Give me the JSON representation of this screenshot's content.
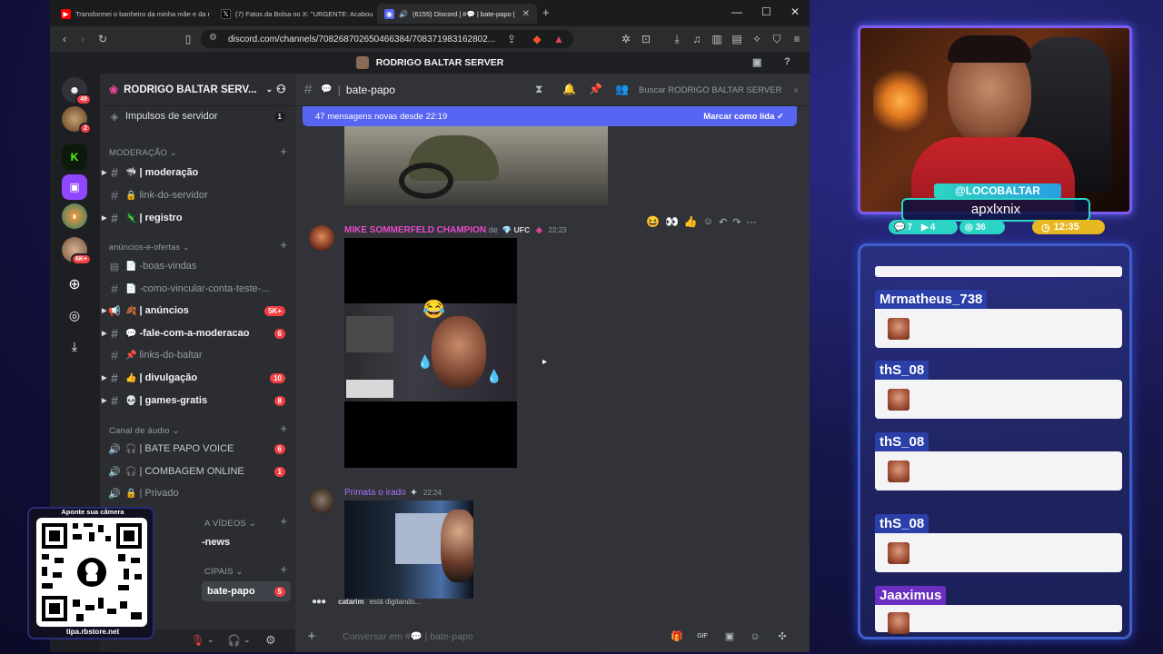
{
  "browser": {
    "tabs": [
      {
        "title": "Transformei o banheiro da minha mãe e da m",
        "icon": "youtube-icon",
        "color": "#ff0000"
      },
      {
        "title": "(7) Fatos da Bolsa no X: \"URGENTE: Acabou",
        "icon": "x-icon",
        "color": "#000000"
      },
      {
        "title": "(6155) Discord | #💬 | bate-papo |",
        "icon": "discord-icon",
        "color": "#5865f2"
      }
    ],
    "url": "discord.com/channels/708268702650466384/708371983162802...",
    "new_tab": "+"
  },
  "discord": {
    "top_title": "RODRIGO BALTAR SERVER",
    "guilds": [
      {
        "badge": "49"
      },
      {
        "badge": "2"
      },
      {
        "badge": ""
      },
      {
        "badge": ""
      },
      {
        "badge": ""
      },
      {
        "badge": "6K+"
      }
    ],
    "server": {
      "name": "RODRIGO BALTAR SERV...",
      "boost": "Impulsos de servidor",
      "boost_count": "1",
      "categories": [
        {
          "label": "MODERAÇÃO ⌄"
        },
        {
          "label": "anúncios-e-ofertas ⌄"
        },
        {
          "label": "Canal de áudio ⌄"
        },
        {
          "label": "A VÍDEOS ⌄"
        },
        {
          "label": "CIPAIS ⌄"
        }
      ],
      "channels": [
        {
          "label": "| moderação",
          "emoji": "🦈",
          "unread": true
        },
        {
          "label": "link-do-servidor",
          "emoji": "🔒",
          "unread": false
        },
        {
          "label": "| registro",
          "emoji": "🦎",
          "unread": true
        },
        {
          "label": "-boas-vindas",
          "emoji": "📄",
          "unread": false
        },
        {
          "label": "-como-vincular-conta-teste-...",
          "emoji": "📄",
          "unread": false
        },
        {
          "label": "| anúncios",
          "emoji": "🍂",
          "unread": true,
          "count": "5K+"
        },
        {
          "label": "-fale-com-a-moderacao",
          "emoji": "💬",
          "unread": true,
          "count": "6"
        },
        {
          "label": "links-do-baltar",
          "emoji": "📌",
          "unread": false
        },
        {
          "label": "| divulgação",
          "emoji": "👍",
          "unread": true,
          "count": "10"
        },
        {
          "label": "| games-gratis",
          "emoji": "💀",
          "unread": true,
          "count": "8"
        },
        {
          "label": "| BATE PAPO VOICE",
          "emoji": "🎧",
          "unread": false,
          "count": "6"
        },
        {
          "label": "| COMBAGEM ONLINE",
          "emoji": "🎧",
          "unread": false,
          "count": "1"
        },
        {
          "label": "| Privado",
          "emoji": "🔒",
          "unread": false
        },
        {
          "label": "-news",
          "emoji": "",
          "unread": true
        },
        {
          "label": "bate-papo",
          "emoji": "",
          "unread": true,
          "count": "5"
        }
      ]
    },
    "chat": {
      "channel": "bate-papo",
      "search_placeholder": "Buscar RODRIGO BALTAR SERVER",
      "new_messages": "47 mensagens novas desde 22:19",
      "mark_read": "Marcar como lida",
      "messages": [
        {
          "author": "MIKE SOMMERFELD CHAMPION",
          "suffix": "de",
          "tag": "UFC",
          "time": "22:23",
          "name_color": "#e84ac9"
        },
        {
          "author": "Primata o irado",
          "time": "22:24",
          "name_color": "#a970ff"
        }
      ],
      "typing_user": "catarim",
      "typing_text": "está digitando...",
      "composer_placeholder": "Conversar em #💬 | bate-papo"
    }
  },
  "qr": {
    "title": "Aponte sua câmera",
    "url": "tipa.rbstore.net"
  },
  "stream": {
    "handle": "@LOCOBALTAR",
    "game": "apxlxnix",
    "stats": [
      {
        "icon": "chat-icon",
        "value": "7"
      },
      {
        "icon": "video-icon",
        "value": "4"
      },
      {
        "icon": "heart-icon",
        "value": "36"
      },
      {
        "icon": "clock-icon",
        "value": "12:35"
      }
    ]
  },
  "chat_overlay": {
    "messages": [
      {
        "user": ""
      },
      {
        "user": "Mrmatheus_738"
      },
      {
        "user": "thS_08"
      },
      {
        "user": "thS_08"
      },
      {
        "user": "thS_08"
      },
      {
        "user": "Jaaximus"
      }
    ]
  },
  "colors": {
    "blurple": "#5865f2",
    "discord_bg": "#313338",
    "sidebar_bg": "#2b2d31",
    "badge_red": "#f23f43",
    "overlay_accent": "#2a3fa8"
  }
}
